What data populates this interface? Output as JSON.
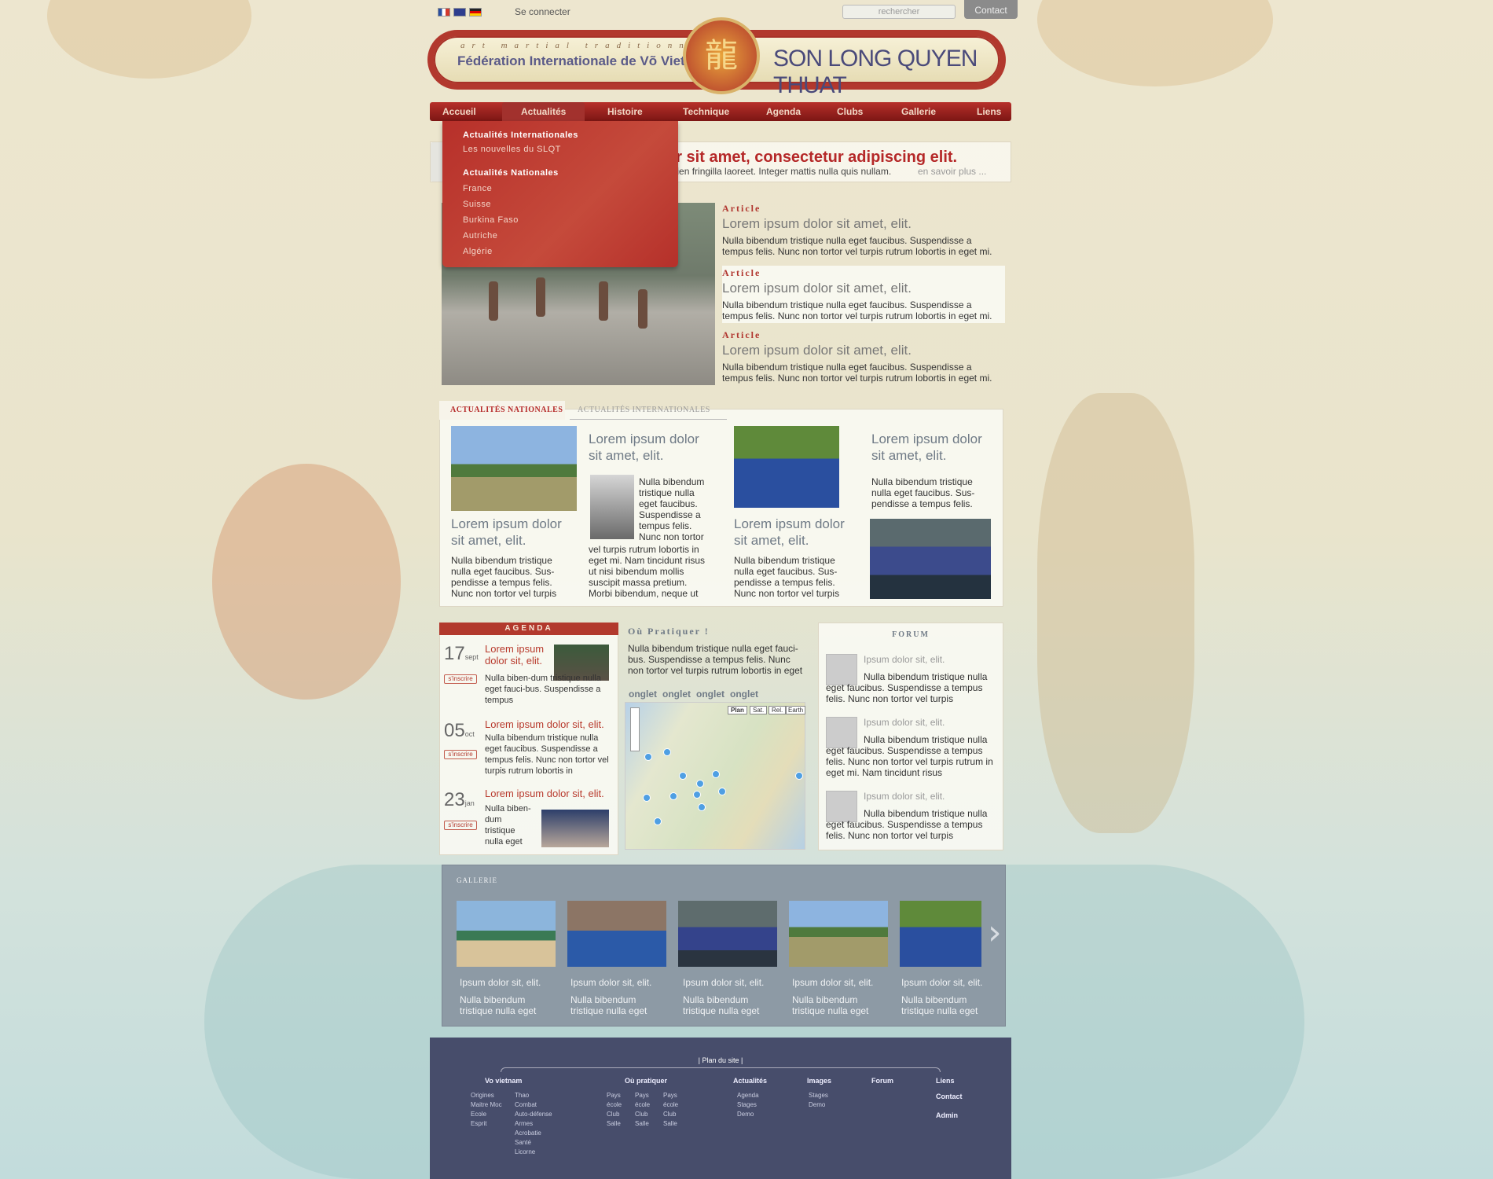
{
  "topbar": {
    "login": "Se connecter",
    "search_placeholder": "rechercher",
    "contact": "Contact"
  },
  "header": {
    "tagline": "art martial traditionnel",
    "federation": "Fédération Internationale de Võ Vietnam",
    "brand": "SON LONG QUYEN THUAT"
  },
  "nav": [
    "Accueil",
    "Actualités",
    "Histoire",
    "Technique",
    "Agenda",
    "Clubs",
    "Gallerie",
    "Liens"
  ],
  "dropdown": {
    "h1": "Actualités Internationales",
    "h1_sub": "Les nouvelles du SLQT",
    "h2": "Actualités Nationales",
    "items": [
      "France",
      "Suisse",
      "Burkina Faso",
      "Autriche",
      "Algérie"
    ]
  },
  "hero": {
    "title": "or sit amet, consectetur adipiscing elit.",
    "text": "apien fringilla laoreet. Integer mattis nulla quis nullam.",
    "more": "en savoir plus ..."
  },
  "articles": [
    {
      "kicker": "Article",
      "title": "Lorem ipsum dolor sit amet, elit.",
      "text": "Nulla bibendum tristique nulla eget faucibus. Suspendisse a tempus felis. Nunc non tortor vel turpis rutrum lobortis in eget mi."
    },
    {
      "kicker": "Article",
      "title": "Lorem ipsum dolor sit amet, elit.",
      "text": "Nulla bibendum tristique nulla eget faucibus. Suspendisse a tempus felis. Nunc non tortor vel turpis rutrum lobortis in eget mi."
    },
    {
      "kicker": "Article",
      "title": "Lorem ipsum dolor sit amet, elit.",
      "text": "Nulla bibendum tristique nulla eget faucibus. Suspendisse a tempus felis. Nunc non tortor vel turpis rutrum lobortis in eget mi."
    }
  ],
  "news_tabs": [
    "ACTUALITÉS NATIONALES",
    "ACTUALITÉS INTERNATIONALES"
  ],
  "news": {
    "c1_title": "Lorem ipsum dolor sit amet, elit.",
    "c1_text": "Nulla bibendum tristique nulla eget faucibus. Sus-pendisse a tempus felis. Nunc non tortor vel turpis",
    "c2_title": "Lorem ipsum dolor sit amet, elit.",
    "c2_text": "Nulla bibendum tristique nulla eget faucibus. Suspendisse a tempus felis. Nunc non tortor",
    "c2_text2": "vel turpis rutrum lobortis in eget mi. Nam tincidunt risus ut nisi bibendum mollis suscipit massa pretium. Morbi bibendum, neque ut",
    "c3_title": "Lorem ipsum dolor sit amet, elit.",
    "c3_text": "Nulla bibendum tristique nulla eget faucibus. Sus-pendisse a tempus felis. Nunc non tortor vel turpis",
    "c4_title": "Lorem ipsum dolor sit amet, elit.",
    "c4_text": "Nulla bibendum tristique nulla eget faucibus. Sus-pendisse a tempus felis."
  },
  "agenda": {
    "title": "AGENDA",
    "events": [
      {
        "day": "17",
        "month": "sept",
        "btn": "s'inscrire",
        "title": "Lorem ipsum dolor sit, elit.",
        "text": "Nulla biben-dum tristique nulla eget fauci-bus. Suspendisse a tempus"
      },
      {
        "day": "05",
        "month": "oct",
        "btn": "s'inscrire",
        "title": "Lorem ipsum dolor sit, elit.",
        "text": "Nulla bibendum tristique nulla eget faucibus. Suspendisse a tempus felis. Nunc non tortor vel turpis rutrum lobortis in"
      },
      {
        "day": "23",
        "month": "jan",
        "btn": "s'inscrire",
        "title": "Lorem ipsum dolor sit, elit.",
        "text": "Nulla biben-dum tristique nulla eget"
      }
    ]
  },
  "pratiquer": {
    "title": "Où Pratiquer !",
    "text": "Nulla bibendum tristique nulla eget fauci-bus. Suspendisse a tempus felis. Nunc non tortor vel turpis rutrum lobortis in eget",
    "tabs": [
      "onglet",
      "onglet",
      "onglet",
      "onglet"
    ],
    "map_btns": [
      "Plan",
      "Sat.",
      "Rel.",
      "Earth"
    ]
  },
  "forum": {
    "title": "FORUM",
    "posts": [
      {
        "title": "Ipsum dolor sit, elit.",
        "text": "Nulla bibendum tristique nulla eget faucibus. Suspendisse a tempus felis. Nunc non tortor vel turpis"
      },
      {
        "title": "Ipsum dolor sit, elit.",
        "text": "Nulla bibendum tristique nulla eget faucibus. Suspendisse a tempus felis. Nunc non tortor vel turpis rutrum in eget mi. Nam tincidunt risus"
      },
      {
        "title": "Ipsum dolor sit, elit.",
        "text": "Nulla bibendum tristique nulla eget faucibus. Suspendisse a tempus felis. Nunc non tortor vel turpis"
      }
    ]
  },
  "gallery": {
    "title": "GALLERIE",
    "items": [
      {
        "cap": "Ipsum dolor sit, elit.",
        "text": "Nulla bibendum tristique nulla eget"
      },
      {
        "cap": "Ipsum dolor sit, elit.",
        "text": "Nulla bibendum tristique nulla eget"
      },
      {
        "cap": "Ipsum dolor sit, elit.",
        "text": "Nulla bibendum tristique nulla eget"
      },
      {
        "cap": "Ipsum dolor sit, elit.",
        "text": "Nulla bibendum tristique nulla eget"
      },
      {
        "cap": "Ipsum dolor sit, elit.",
        "text": "Nulla bibendum tristique nulla eget"
      }
    ]
  },
  "footer": {
    "sitemap": "| Plan du site |",
    "cols": [
      {
        "h": "Vo vietnam",
        "a": [
          "Origines",
          "Maitre Moc",
          "Ecole",
          "Esprit"
        ],
        "b": [
          "Thao",
          "Combat",
          "Auto-défense",
          "Armes",
          "Acrobatie",
          "Santé",
          "Licorne"
        ]
      },
      {
        "h": "Où pratiquer",
        "a": [
          "Pays",
          "école",
          "Club",
          "Salle"
        ],
        "b": [
          "Pays",
          "école",
          "Club",
          "Salle"
        ],
        "c": [
          "Pays",
          "école",
          "Club",
          "Salle"
        ]
      },
      {
        "h": "Actualités",
        "a": [
          "Agenda",
          "Stages",
          "Demo"
        ]
      },
      {
        "h": "Images",
        "a": [
          "Stages",
          "Demo"
        ]
      },
      {
        "h": "Forum"
      },
      {
        "h": "Liens",
        "a": [
          "Contact",
          "Admin"
        ]
      }
    ]
  }
}
